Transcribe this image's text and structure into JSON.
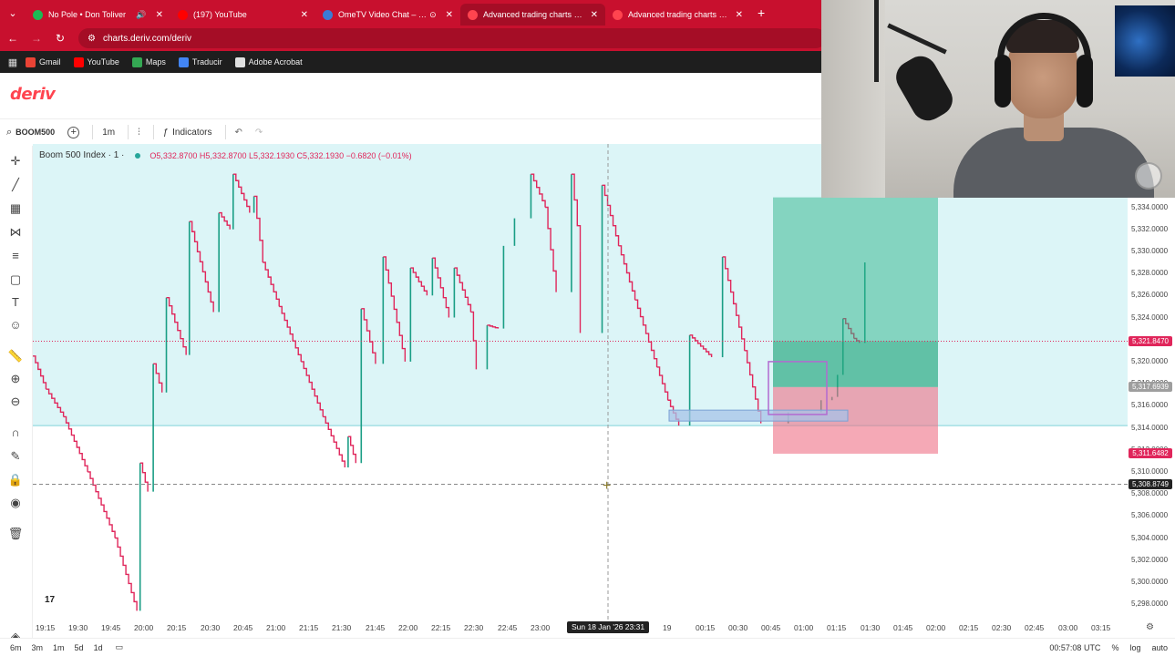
{
  "browser": {
    "tabs": [
      {
        "title": "No Pole • Don Toliver",
        "favicon_color": "#1db954",
        "extra": "🔊"
      },
      {
        "title": "(197) YouTube",
        "favicon_color": "#ff0000",
        "extra": ""
      },
      {
        "title": "OmeTV Video Chat – Omegle",
        "favicon_color": "#3a7bd5",
        "extra": "⊙"
      },
      {
        "title": "Advanced trading charts & tools",
        "favicon_color": "#ff444f",
        "extra": "",
        "active": true
      },
      {
        "title": "Advanced trading charts & tools",
        "favicon_color": "#ff444f",
        "extra": ""
      }
    ],
    "url": "charts.deriv.com/deriv",
    "bookmarks": [
      {
        "label": "Gmail",
        "color": "#ea4335"
      },
      {
        "label": "YouTube",
        "color": "#ff0000"
      },
      {
        "label": "Maps",
        "color": "#34a853"
      },
      {
        "label": "Traducir",
        "color": "#4285f4"
      },
      {
        "label": "Adobe Acrobat",
        "color": "#e0e0e0"
      }
    ]
  },
  "app": {
    "logo": "deriv"
  },
  "toolbar": {
    "symbol": "BOOM500",
    "interval": "1m",
    "indicators": "Indicators"
  },
  "legend": {
    "symbol_name": "Boom 500 Index · 1 ·",
    "ohlc": "O5,332.8700 H5,332.8700 L5,332.1930 C5,332.1930 −0.6820 (−0.01%)"
  },
  "chart_data": {
    "type": "line",
    "title": "Boom 500 Index · 1",
    "ylim": [
      5297,
      5335
    ],
    "y_ticks": [
      "5,334.0000",
      "5,332.0000",
      "5,330.0000",
      "5,328.0000",
      "5,326.0000",
      "5,324.0000",
      "5,322.0000",
      "5,320.0000",
      "5,318.0000",
      "5,316.0000",
      "5,314.0000",
      "5,312.0000",
      "5,310.0000",
      "5,308.0000",
      "5,306.0000",
      "5,304.0000",
      "5,302.0000",
      "5,300.0000",
      "5,298.0000"
    ],
    "x_ticks": [
      "19:15",
      "19:30",
      "19:45",
      "20:00",
      "20:15",
      "20:30",
      "20:45",
      "21:00",
      "21:15",
      "21:30",
      "21:45",
      "22:00",
      "22:15",
      "22:30",
      "22:45",
      "23:00",
      "19",
      "00:15",
      "00:30",
      "00:45",
      "01:00",
      "01:15",
      "01:30",
      "01:45",
      "02:00",
      "02:15",
      "02:30",
      "02:45",
      "03:00",
      "03:15"
    ],
    "price_badges": [
      {
        "label": "5,321.8470",
        "value": 5321.847,
        "color": "#e0265b"
      },
      {
        "label": "5,317.6939",
        "value": 5317.6939,
        "color": "#9e9e9e"
      },
      {
        "label": "5,311.6482",
        "value": 5311.6482,
        "color": "#e0265b"
      },
      {
        "label": "5,308.8749",
        "value": 5308.8749,
        "color": "#222222"
      }
    ],
    "crosshair_time": "Sun 18 Jan '26  23:31",
    "zone_top": 5334.8,
    "zone_bottom": 5314.2,
    "series": [
      {
        "name": "Boom 500 Index",
        "points": [
          [
            0,
            5320.5
          ],
          [
            0.012,
            5317.5
          ],
          [
            0.028,
            5315
          ],
          [
            0.05,
            5310
          ],
          [
            0.075,
            5304
          ],
          [
            0.095,
            5297.4
          ],
          [
            0.098,
            5310.8
          ],
          [
            0.105,
            5308.2
          ],
          [
            0.11,
            5319.8
          ],
          [
            0.118,
            5317.2
          ],
          [
            0.122,
            5325.8
          ],
          [
            0.14,
            5320.6
          ],
          [
            0.143,
            5332.7
          ],
          [
            0.165,
            5324.5
          ],
          [
            0.17,
            5333.5
          ],
          [
            0.18,
            5332
          ],
          [
            0.183,
            5337
          ],
          [
            0.198,
            5333.5
          ],
          [
            0.202,
            5335
          ],
          [
            0.21,
            5329
          ],
          [
            0.225,
            5325
          ],
          [
            0.245,
            5320
          ],
          [
            0.265,
            5315
          ],
          [
            0.285,
            5310.4
          ],
          [
            0.288,
            5313.2
          ],
          [
            0.295,
            5310.8
          ],
          [
            0.3,
            5324.8
          ],
          [
            0.313,
            5319.8
          ],
          [
            0.32,
            5329.5
          ],
          [
            0.34,
            5320
          ],
          [
            0.345,
            5328.5
          ],
          [
            0.36,
            5326
          ],
          [
            0.365,
            5329.4
          ],
          [
            0.38,
            5324
          ],
          [
            0.385,
            5328.5
          ],
          [
            0.4,
            5324.5
          ],
          [
            0.405,
            5319.3
          ],
          [
            0.415,
            5323.3
          ],
          [
            0.425,
            5323
          ],
          [
            0.43,
            5330.5
          ],
          [
            0.44,
            5333
          ],
          [
            0.455,
            5337
          ],
          [
            0.468,
            5334
          ],
          [
            0.478,
            5326.3
          ],
          [
            0.492,
            5337
          ],
          [
            0.5,
            5330
          ],
          [
            0.5,
            5322.6
          ],
          [
            0.52,
            5336
          ],
          [
            0.535,
            5330.5
          ],
          [
            0.55,
            5325.6
          ],
          [
            0.57,
            5319.5
          ],
          [
            0.58,
            5316.5
          ],
          [
            0.59,
            5314.2
          ],
          [
            0.6,
            5322.4
          ],
          [
            0.62,
            5320.4
          ],
          [
            0.63,
            5329.5
          ],
          [
            0.65,
            5321
          ],
          [
            0.665,
            5314.4
          ],
          [
            0.69,
            5315.4
          ],
          [
            0.72,
            5316.5
          ],
          [
            0.73,
            5316.8
          ],
          [
            0.735,
            5318.8
          ],
          [
            0.74,
            5323.9
          ],
          [
            0.75,
            5322.1
          ],
          [
            0.755,
            5321.7
          ],
          [
            0.76,
            5329
          ]
        ]
      }
    ],
    "long_position": {
      "entry": 5317.6939,
      "target": 5334.9,
      "stop": 5311.6482
    }
  },
  "status": {
    "timeframes": [
      "6m",
      "3m",
      "1m",
      "5d",
      "1d"
    ],
    "clock": "00:57:08 UTC",
    "scale_options": [
      "%",
      "log",
      "auto"
    ]
  }
}
